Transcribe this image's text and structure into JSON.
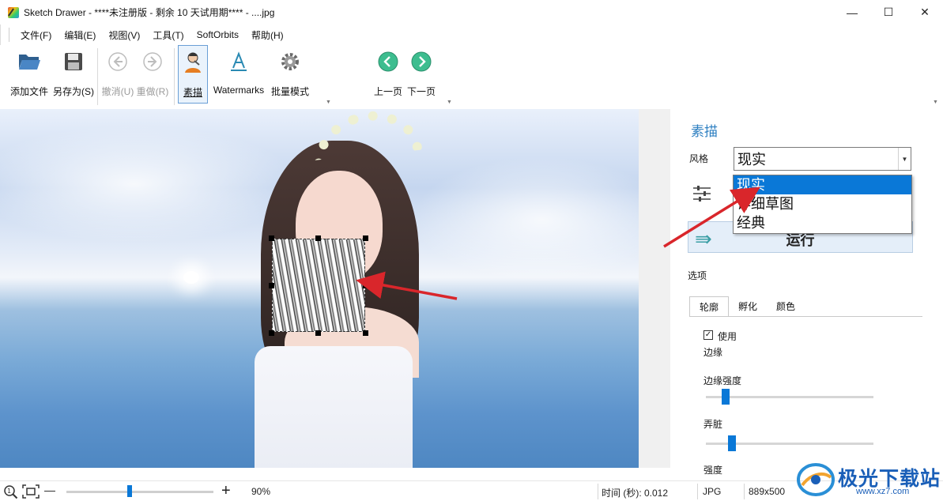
{
  "window": {
    "title": "Sketch Drawer - ****未注册版 - 剩余 10 天试用期**** - ....jpg",
    "min_glyph": "—",
    "max_glyph": "☐",
    "close_glyph": "✕"
  },
  "menu": {
    "items": [
      "文件(F)",
      "编辑(E)",
      "视图(V)",
      "工具(T)",
      "SoftOrbits",
      "帮助(H)"
    ]
  },
  "toolbar": {
    "add_file": "添加文件",
    "save_as": "另存为(S)",
    "undo": "撤消(U)",
    "redo": "重做(R)",
    "sketch": "素描",
    "watermarks": "Watermarks",
    "batch": "批量模式",
    "prev_page": "上一页",
    "next_page": "下一页"
  },
  "panel": {
    "title": "素描",
    "style_label": "风格",
    "style_value": "现实",
    "style_options": [
      "现实",
      "详细草图",
      "经典"
    ],
    "run_label": "运行",
    "options_label": "选项",
    "tabs": [
      "轮廓",
      "孵化",
      "颜色"
    ],
    "use_label": "使用",
    "use_checked": true,
    "edge_label": "边缘",
    "edge_strength_label": "边缘强度",
    "edge_strength_level": 0.1,
    "smudge_label": "弄脏",
    "smudge_level": 0.14,
    "strength_label": "强度"
  },
  "status": {
    "zoom_minus": "—",
    "zoom_plus": "+",
    "zoom_value": "90%",
    "zoom_level": 0.43,
    "time_label": "时间 (秒): 0.012",
    "format": "JPG",
    "dimensions": "889x500"
  },
  "watermark": {
    "text": "极光下载站",
    "sub": "www.xz7.com"
  },
  "colors": {
    "accent": "#0a78d7",
    "panel_title": "#2d7fc1",
    "arrow": "#d9262b"
  }
}
